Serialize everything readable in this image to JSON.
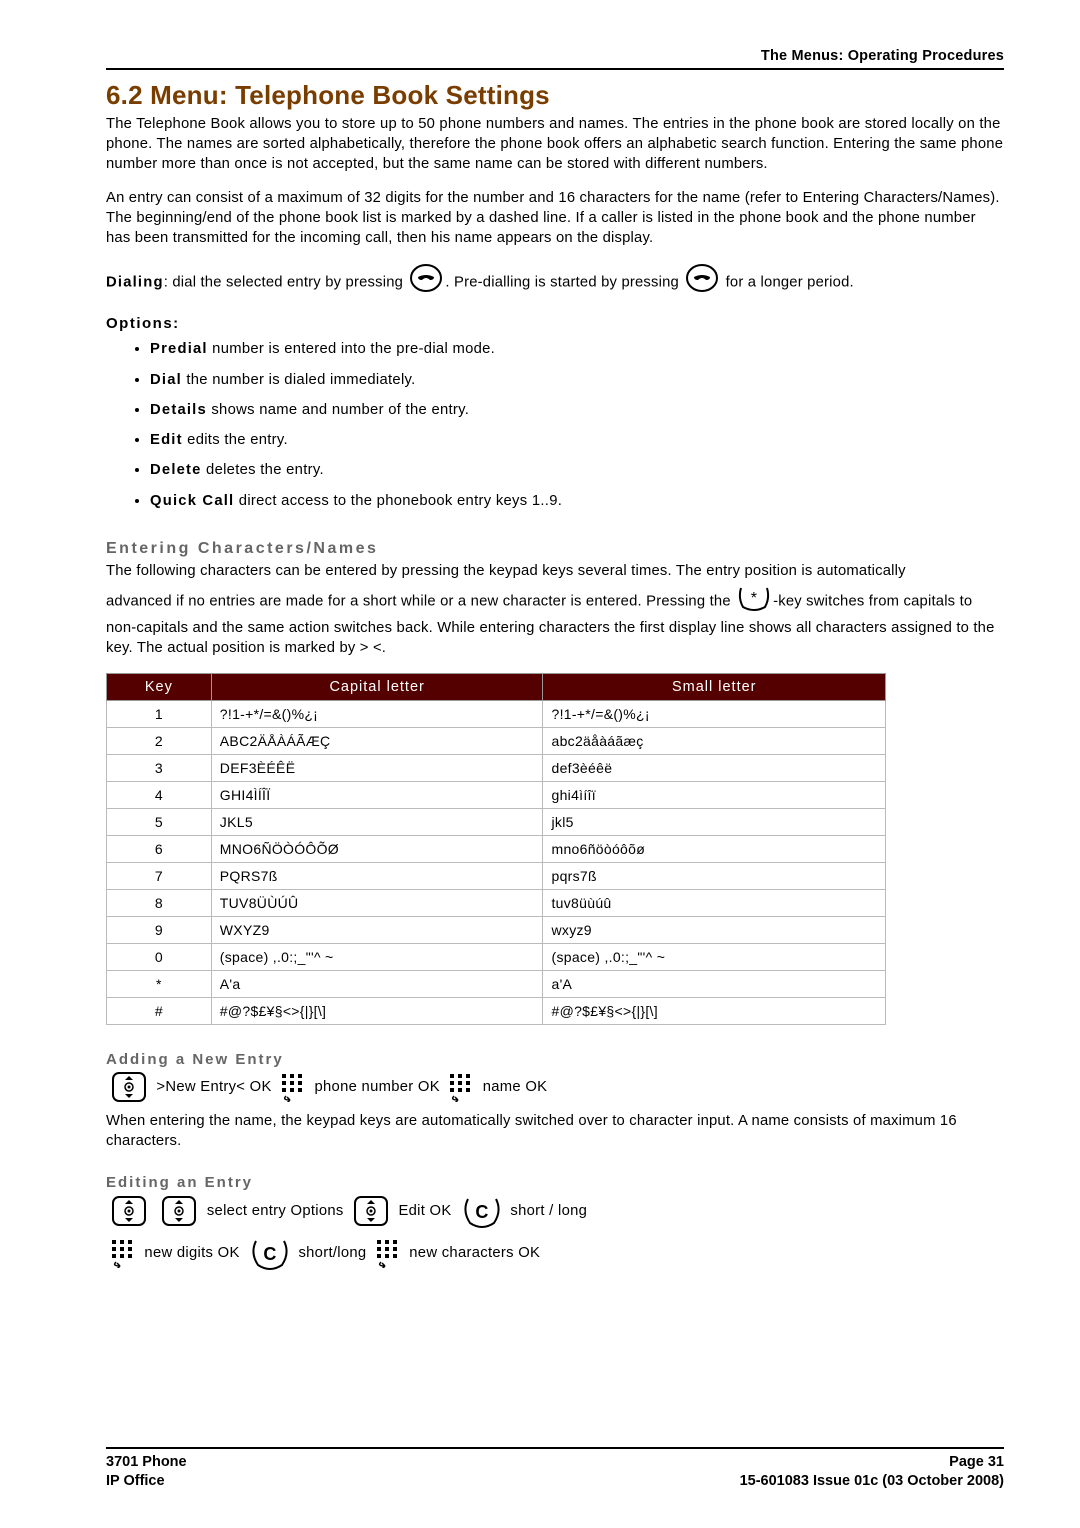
{
  "header_right": "The Menus: Operating Procedures",
  "section_title": "6.2 Menu: Telephone Book Settings",
  "para1": "The Telephone Book allows you to store up to 50 phone numbers and names. The entries in the phone book are stored locally on the phone. The names are sorted alphabetically, therefore the phone book offers an alphabetic search function. Entering the same phone number more than once is not accepted, but the same name can be stored with different numbers.",
  "para2": "An entry can consist of a maximum of 32 digits for the number and 16 characters for the name (refer to Entering Characters/Names). The beginning/end of the phone book list is marked by a dashed line. If a caller is listed in the phone book and the phone number has been transmitted for the incoming call, then his name appears on the display.",
  "dial_label": "Dialing",
  "dial_text_a": ": dial the selected entry by pressing ",
  "dial_text_b": ". Pre-dialling is started by pressing ",
  "dial_text_c": " for a longer period.",
  "options_label": "Options:",
  "options": [
    {
      "b": "Predial",
      "rest": " number is entered into the pre-dial mode."
    },
    {
      "b": "Dial",
      "rest": " the number is dialed immediately."
    },
    {
      "b": "Details",
      "rest": " shows name and number of the entry."
    },
    {
      "b": "Edit",
      "rest": " edits the entry."
    },
    {
      "b": "Delete",
      "rest": " deletes the entry."
    },
    {
      "b": "Quick Call",
      "rest": " direct access to the phonebook entry keys 1..9."
    }
  ],
  "entering_head": "Entering Characters/Names",
  "entering_p1": "The following characters can be entered by pressing the keypad keys several times. The entry position is automatically",
  "entering_p2a": "advanced if no entries are made for a short while or a new character is entered. Pressing the ",
  "entering_p2b": "-key switches from capitals to non-capitals and the same action switches back. While entering characters the first display line shows all characters assigned to the key. The actual position is marked by > <.",
  "table_headers": {
    "key": "Key",
    "cap": "Capital letter",
    "small": "Small letter"
  },
  "chart_data": {
    "type": "table",
    "title": "Keypad character map",
    "columns": [
      "Key",
      "Capital letter",
      "Small letter"
    ],
    "rows": [
      [
        "1",
        "?!1-+*/=&()%¿¡",
        "?!1-+*/=&()%¿¡"
      ],
      [
        "2",
        "ABC2ÄÅÀÁÃÆÇ",
        "abc2äåàáãæç"
      ],
      [
        "3",
        "DEF3ÈÉÊË",
        "def3èéêë"
      ],
      [
        "4",
        "GHI4ÌÍÎÏ",
        "ghi4ìíîï"
      ],
      [
        "5",
        "JKL5",
        "jkl5"
      ],
      [
        "6",
        "MNO6ÑÖÒÓÔÕØ",
        "mno6ñöòóôõø"
      ],
      [
        "7",
        "PQRS7ß",
        "pqrs7ß"
      ],
      [
        "8",
        "TUV8ÜÙÚÛ",
        "tuv8üùúû"
      ],
      [
        "9",
        "WXYZ9",
        "wxyz9"
      ],
      [
        "0",
        "(space) ,.0:;_\"'^ ~",
        "(space) ,.0:;_\"'^ ~"
      ],
      [
        "*",
        "A'a",
        "a'A"
      ],
      [
        "#",
        "#@?$£¥§<>{|}[\\]",
        "#@?$£¥§<>{|}[\\]"
      ]
    ]
  },
  "adding_head": "Adding a New Entry",
  "adding_a": " >New Entry< OK ",
  "adding_b": " phone number OK ",
  "adding_c": " name OK",
  "adding_para": "When entering the name, the keypad keys are automatically switched over to character input. A name consists of maximum 16 characters.",
  "editing_head": "Editing an Entry",
  "edit_a": " select entry Options ",
  "edit_b": " Edit OK ",
  "edit_c": " short / long",
  "edit_d": " new digits OK ",
  "edit_e": " short/long ",
  "edit_f": " new characters OK",
  "footer": {
    "left1": "3701 Phone",
    "left2": "IP Office",
    "right1": "Page 31",
    "right2": "15-601083 Issue 01c (03 October 2008)"
  }
}
